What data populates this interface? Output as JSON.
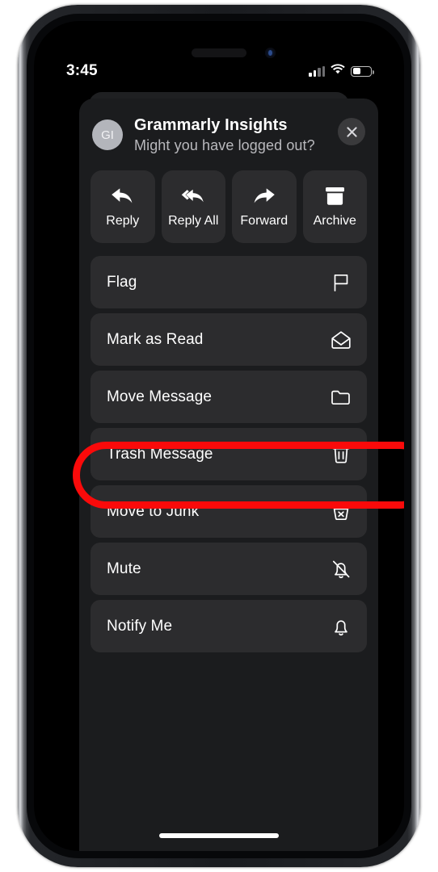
{
  "status_bar": {
    "time": "3:45",
    "signal_icon": "cellular-signal-icon",
    "signal_bars_total": 4,
    "signal_bars_filled": 2,
    "wifi_icon": "wifi-icon",
    "battery_icon": "battery-icon",
    "battery_percent": 40
  },
  "message": {
    "avatar_initials": "GI",
    "sender_name": "Grammarly Insights",
    "preview_text": "Might you have logged out?",
    "close_label": "close-icon"
  },
  "quick_actions": [
    {
      "label": "Reply",
      "icon": "reply-arrow-icon"
    },
    {
      "label": "Reply All",
      "icon": "reply-all-arrow-icon"
    },
    {
      "label": "Forward",
      "icon": "forward-arrow-icon"
    },
    {
      "label": "Archive",
      "icon": "archive-box-icon"
    }
  ],
  "menu_items": [
    {
      "label": "Flag",
      "icon": "flag-icon",
      "highlighted": false
    },
    {
      "label": "Mark as Read",
      "icon": "open-envelope-icon",
      "highlighted": false
    },
    {
      "label": "Move Message",
      "icon": "folder-icon",
      "highlighted": false
    },
    {
      "label": "Trash Message",
      "icon": "trash-can-icon",
      "highlighted": true
    },
    {
      "label": "Move to Junk",
      "icon": "junk-bin-x-icon",
      "highlighted": false
    },
    {
      "label": "Mute",
      "icon": "bell-slash-icon",
      "highlighted": false
    },
    {
      "label": "Notify Me",
      "icon": "bell-icon",
      "highlighted": false
    }
  ],
  "annotation": {
    "type": "oval-highlight",
    "target": "Trash Message",
    "color": "#fa0a0a"
  },
  "theme": {
    "screen_background": "#000000",
    "sheet_background": "#1b1c1e",
    "row_background": "#2c2c2e",
    "primary_text": "#ffffff",
    "secondary_text": "#b9b9bd"
  }
}
